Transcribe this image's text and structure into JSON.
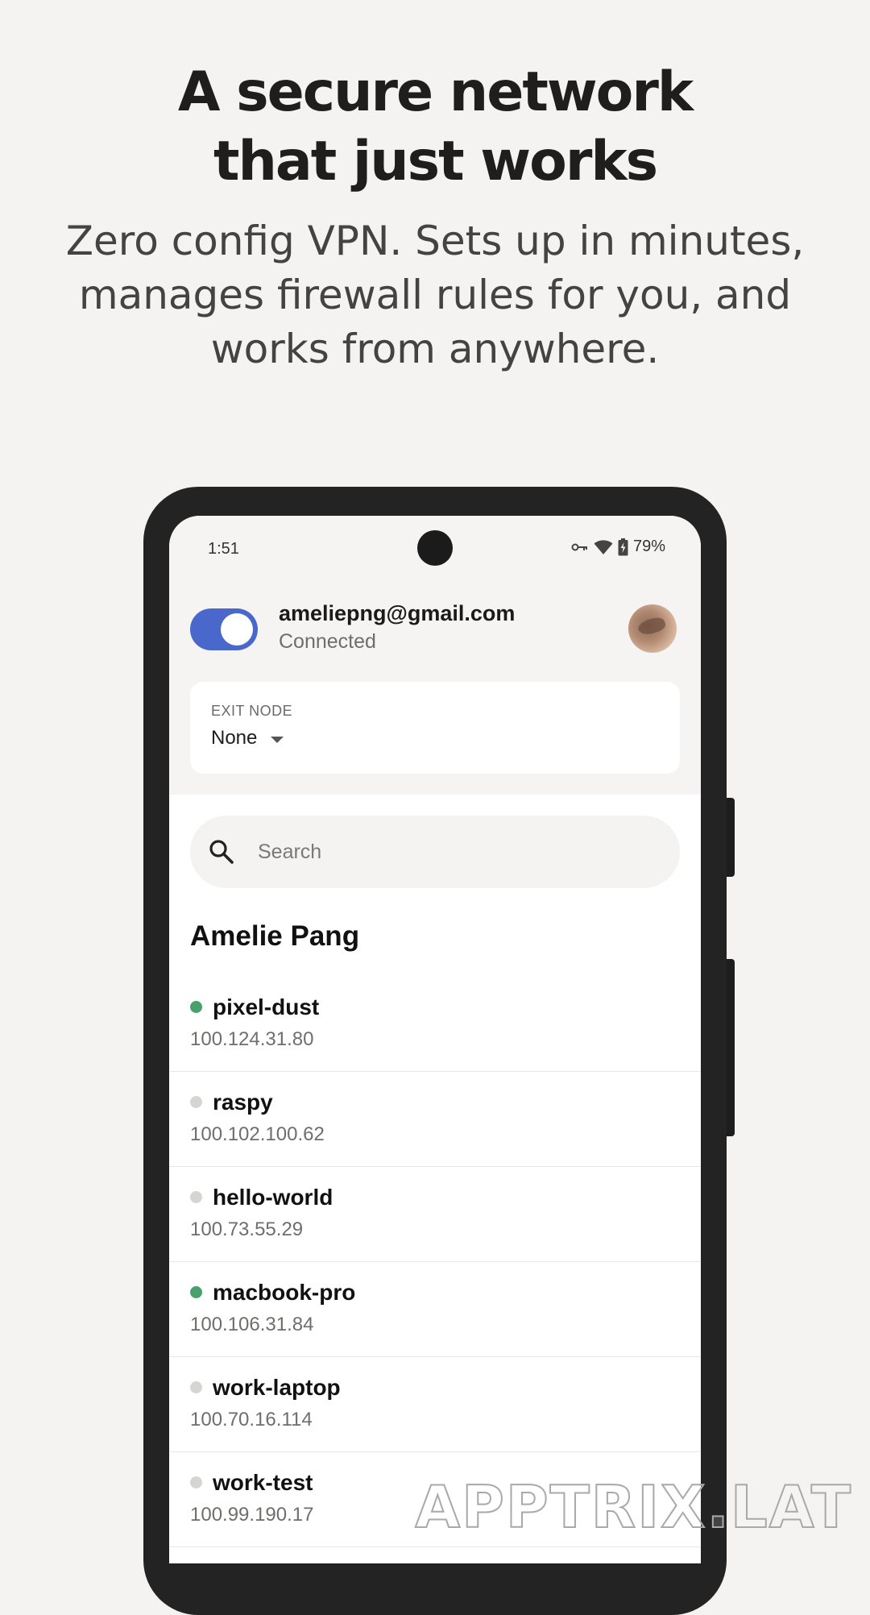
{
  "marketing": {
    "headline": "A secure network\nthat just works",
    "subheadline": "Zero config VPN. Sets up in minutes, manages firewall rules for you, and works from anywhere."
  },
  "status_bar": {
    "time": "1:51",
    "battery": "79%",
    "icons": [
      "vpn-key-icon",
      "wifi-icon",
      "battery-charging-icon"
    ]
  },
  "account": {
    "email": "ameliepng@gmail.com",
    "status": "Connected",
    "vpn_enabled": true
  },
  "exit_node": {
    "label": "EXIT NODE",
    "value": "None"
  },
  "search": {
    "placeholder": "Search"
  },
  "section": {
    "title": "Amelie Pang"
  },
  "devices": [
    {
      "name": "pixel-dust",
      "ip": "100.124.31.80",
      "online": true
    },
    {
      "name": "raspy",
      "ip": "100.102.100.62",
      "online": false
    },
    {
      "name": "hello-world",
      "ip": "100.73.55.29",
      "online": false
    },
    {
      "name": "macbook-pro",
      "ip": "100.106.31.84",
      "online": true
    },
    {
      "name": "work-laptop",
      "ip": "100.70.16.114",
      "online": false
    },
    {
      "name": "work-test",
      "ip": "100.99.190.17",
      "online": false
    }
  ],
  "colors": {
    "accent": "#4a67cc",
    "online": "#4aa06c",
    "offline": "#d6d5d3",
    "background": "#f4f3f1"
  },
  "watermark": "APPTRIX.LAT"
}
